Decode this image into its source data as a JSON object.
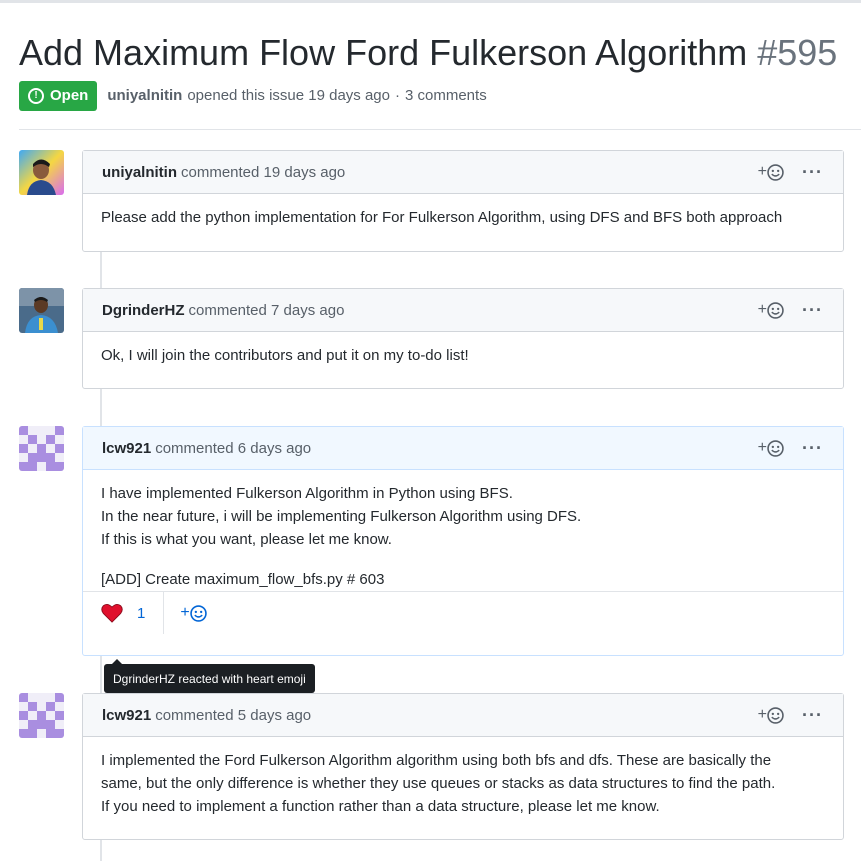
{
  "issue": {
    "title": "Add Maximum Flow Ford Fulkerson Algorithm",
    "number": "#595",
    "state": "Open",
    "author": "uniyalnitin",
    "opened_text": "opened this issue 19 days ago",
    "comments_count": "3 comments"
  },
  "comments": [
    {
      "author": "uniyalnitin",
      "time": "commented 19 days ago",
      "body": [
        "Please add the python implementation for For Fulkerson Algorithm, using DFS and BFS both approach"
      ]
    },
    {
      "author": "DgrinderHZ",
      "time": "commented 7 days ago",
      "body": [
        "Ok, I will join the contributors and put it on my to-do list!"
      ]
    },
    {
      "author": "lcw921",
      "time": "commented 6 days ago",
      "body": [
        "I have implemented Fulkerson Algorithm in Python using BFS.",
        "In the near future, i will be implementing Fulkerson Algorithm using DFS.",
        "If this is what you want, please let me know.",
        "[ADD] Create maximum_flow_bfs.py # 603"
      ],
      "reaction_count": "1"
    },
    {
      "author": "lcw921",
      "time": "commented 5 days ago",
      "body": [
        "I implemented the Ford Fulkerson Algorithm algorithm using both bfs and dfs. These are basically the",
        "same, but the only difference is whether they use queues or stacks as data structures to find the path.",
        "If you need to implement a function rather than a data structure, please let me know."
      ]
    }
  ],
  "tooltip": "DgrinderHZ reacted with heart emoji",
  "ui": {
    "add_reaction": "+",
    "more": "···",
    "state_icon": "!"
  },
  "colors": {
    "open_green": "#28a745",
    "link_blue": "#0366d6",
    "heart_red": "#e0102d"
  }
}
